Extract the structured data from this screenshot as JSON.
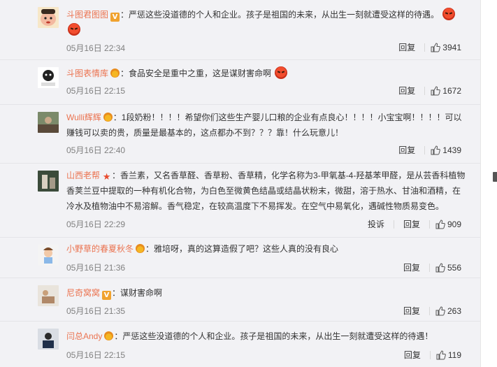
{
  "comments": [
    {
      "user": "斗图君图图",
      "badge": "v",
      "text": "：严惩这些没道德的个人和企业。孩子是祖国的未来，从出生一刻就遭受这样的待遇。",
      "emojis": 2,
      "time": "05月16日 22:34",
      "reply": "回复",
      "likes": "3941"
    },
    {
      "user": "斗图表情库",
      "badge": "vip",
      "text": "：食品安全是重中之重，这是谋财害命啊",
      "emojis": 1,
      "time": "05月16日 22:15",
      "reply": "回复",
      "likes": "1672"
    },
    {
      "user": "Wulli辉辉",
      "badge": "vip",
      "text": "：1段奶粉！！！！希望你们这些生产婴儿口粮的企业有点良心！！！！小宝宝啊！！！！可以赚钱可以卖的贵，质量是最基本的，这点都办不到？？？靠！什么玩意儿！",
      "emojis": 0,
      "time": "05月16日 22:40",
      "reply": "回复",
      "likes": "1439"
    },
    {
      "user": "山西老帮",
      "badge": "star",
      "text": "：香兰素，又名香草醛、香草粉、香草精，化学名称为3-甲氧基-4-羟基苯甲醛，是从芸香科植物香荚兰豆中提取的一种有机化合物，为白色至微黄色结晶或结晶状粉末，微甜，溶于热水、甘油和酒精，在冷水及植物油中不易溶解。香气稳定，在较高温度下不易挥发。在空气中易氧化，遇碱性物质易变色。",
      "emojis": 0,
      "time": "05月16日 22:29",
      "report": "投诉",
      "reply": "回复",
      "likes": "909"
    },
    {
      "user": "小野草的春夏秋冬",
      "badge": "vip",
      "text": "：雅培呀，真的这算造假了吧？这些人真的没有良心",
      "emojis": 0,
      "time": "05月16日 21:36",
      "reply": "回复",
      "likes": "556"
    },
    {
      "user": "尼奇窝窝",
      "badge": "v",
      "text": "：谋财害命啊",
      "emojis": 0,
      "time": "05月16日 21:35",
      "reply": "回复",
      "likes": "263"
    },
    {
      "user": "闫总Andy",
      "badge": "vip",
      "text": "：严惩这些没道德的个人和企业。孩子是祖国的未来，从出生一刻就遭受这样的待遇！",
      "emojis": 0,
      "time": "05月16日 22:15",
      "reply": "回复",
      "likes": "119"
    }
  ],
  "icons": {
    "like": "thumbs-up-icon",
    "verified": "v-badge-icon",
    "vip": "vip-crown-icon",
    "emoji": "angry-face-icon"
  },
  "colors": {
    "username": "#eb7350",
    "background": "#f2f2f5",
    "meta": "#808080"
  }
}
